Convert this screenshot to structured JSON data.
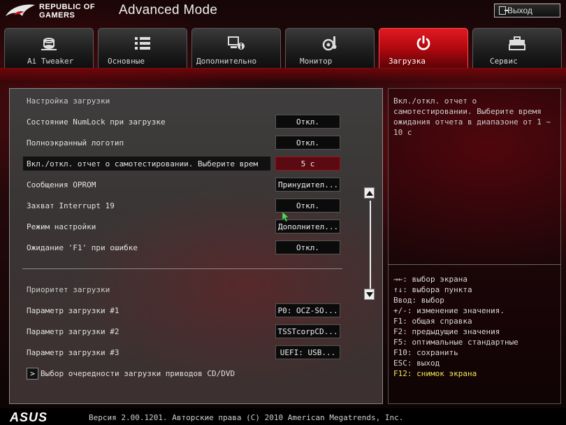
{
  "header": {
    "brand_line1": "REPUBLIC OF",
    "brand_line2": "GAMERS",
    "mode_title": "Advanced Mode",
    "exit_label": "Выход"
  },
  "tabs": [
    {
      "label": "Ai Tweaker",
      "icon": "ai-tweaker-icon",
      "active": false
    },
    {
      "label": "Основные",
      "icon": "list-icon",
      "active": false
    },
    {
      "label": "Дополнительно",
      "icon": "advanced-info-icon",
      "active": false
    },
    {
      "label": "Монитор",
      "icon": "monitor-thermometer-icon",
      "active": false
    },
    {
      "label": "Загрузка",
      "icon": "power-icon",
      "active": true
    },
    {
      "label": "Сервис",
      "icon": "toolbox-icon",
      "active": false
    }
  ],
  "boot": {
    "section_title": "Настройка загрузки",
    "rows": [
      {
        "label": "Состояние NumLock при загрузке",
        "value": "Откл."
      },
      {
        "label": "Полноэкранный логотип",
        "value": "Откл."
      },
      {
        "label": "Вкл./откл. отчет о самотестировании. Выберите врем",
        "value": "5 с"
      },
      {
        "label": "Сообщения OPROM",
        "value": "Принудител..."
      },
      {
        "label": "Захват Interrupt 19",
        "value": "Откл."
      },
      {
        "label": "Режим настройки",
        "value": "Дополнител..."
      },
      {
        "label": "Ожидание 'F1' при ошибке",
        "value": "Откл."
      }
    ]
  },
  "priority": {
    "section_title": "Приоритет загрузки",
    "rows": [
      {
        "label": "Параметр загрузки #1",
        "value": "P0: OCZ-SO..."
      },
      {
        "label": "Параметр загрузки #2",
        "value": "TSSTcorpCD..."
      },
      {
        "label": "Параметр загрузки #3",
        "value": "UEFI:  USB..."
      }
    ],
    "submenu_label": "Выбор очередности загрузки приводов CD/DVD",
    "submenu_arrow": ">"
  },
  "help": {
    "description": "Вкл./откл. отчет о самотестировании. Выберите время ожидания отчета в диапазоне от 1 ~ 10 с",
    "keys": [
      "→←: выбор экрана",
      "↑↓: выбора пункта",
      "Ввод: выбор",
      "+/-: изменение значения.",
      "F1: общая справка",
      "F2: предыдущие значения",
      "F5: оптимальные стандартные",
      "F10: сохранить",
      "ESC: выход",
      "F12: снимок экрана"
    ]
  },
  "footer": {
    "logo": "ASUS",
    "copyright": "Версия 2.00.1201. Авторские права (C) 2010 American Megatrends, Inc."
  },
  "colors": {
    "accent_red": "#c8101a",
    "selected_value_bg": "#5a0a10",
    "highlight_key": "#f1e65a"
  }
}
